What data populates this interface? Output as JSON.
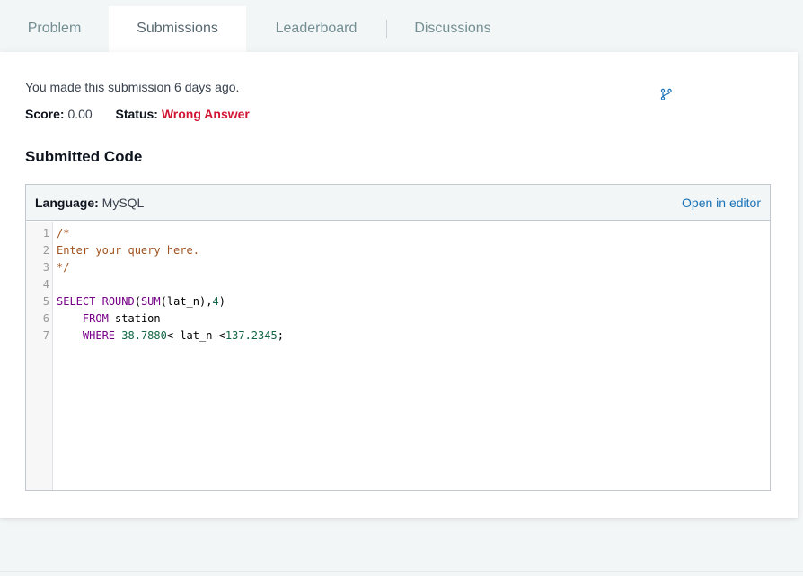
{
  "tabs": [
    {
      "label": "Problem",
      "active": false
    },
    {
      "label": "Submissions",
      "active": true
    },
    {
      "label": "Leaderboard",
      "active": false
    },
    {
      "label": "Discussions",
      "active": false
    }
  ],
  "submission": {
    "note": "You made this submission 6 days ago.",
    "score_label": "Score:",
    "score_value": "0.00",
    "status_label": "Status:",
    "status_value": "Wrong Answer",
    "status_color": "#d11534"
  },
  "section_title": "Submitted Code",
  "code": {
    "language_label": "Language:",
    "language_value": "MySQL",
    "open_in_editor": "Open in editor",
    "line_numbers": [
      "1",
      "2",
      "3",
      "4",
      "5",
      "6",
      "7"
    ],
    "lines": [
      {
        "text": "/*"
      },
      {
        "text": "Enter your query here."
      },
      {
        "text": "*/"
      },
      {
        "text": ""
      },
      {
        "text": "SELECT ROUND(SUM(lat_n),4)"
      },
      {
        "text": "    FROM station"
      },
      {
        "text": "    WHERE 38.7880< lat_n <137.2345;"
      }
    ]
  },
  "icons": {
    "branch": "git-branch-icon"
  },
  "colors": {
    "link": "#1a73b8",
    "background": "#f3f6f7"
  }
}
